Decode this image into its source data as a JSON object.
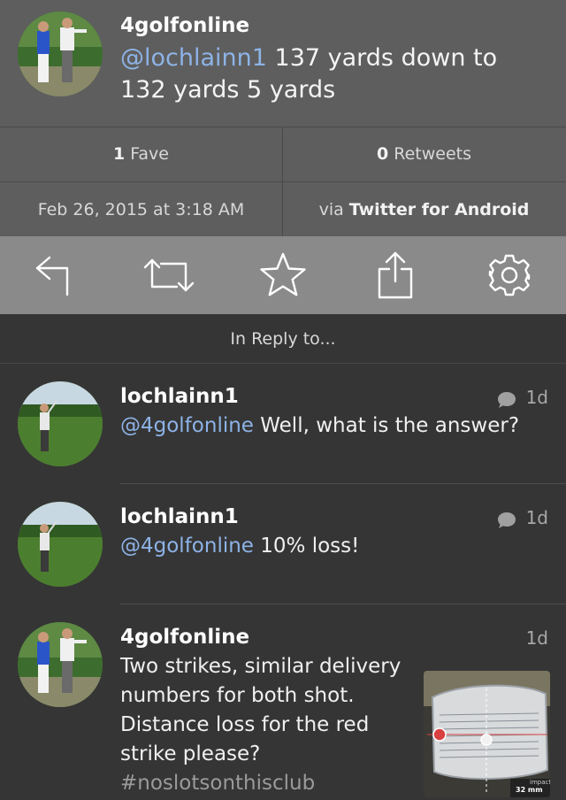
{
  "main_tweet": {
    "username": "4golfonline",
    "mention": "@lochlainn1",
    "text": " 137 yards down to 132 yards 5 yards"
  },
  "stats": {
    "faves_count": "1",
    "faves_label": "Fave",
    "retweets_count": "0",
    "retweets_label": "Retweets",
    "date": "Feb 26, 2015 at 3:18 AM",
    "via_prefix": "via",
    "via_app": "Twitter for Android"
  },
  "actions": [
    {
      "icon": "reply-icon"
    },
    {
      "icon": "retweet-icon"
    },
    {
      "icon": "star-icon"
    },
    {
      "icon": "share-icon"
    },
    {
      "icon": "gear-icon"
    }
  ],
  "in_reply_label": "In Reply to...",
  "replies": [
    {
      "username": "lochlainn1",
      "mention": "@4golfonline",
      "text": " Well, what is the answer?",
      "time": "1d",
      "has_bubble": true
    },
    {
      "username": "lochlainn1",
      "mention": "@4golfonline",
      "text": " 10% loss!",
      "time": "1d",
      "has_bubble": true
    },
    {
      "username": "4golfonline",
      "text": "Two strikes, similar delivery numbers for both shot. Distance loss for the red strike please?",
      "hashtag": "#noslotsonthisclub",
      "time": "1d",
      "has_bubble": false
    }
  ],
  "thumbnail": {
    "label": "impact",
    "value": "32 mm"
  },
  "colors": {
    "header_bg": "#5e5e5e",
    "action_bar_bg": "#8a8a8a",
    "body_bg": "#353535",
    "mention": "#8db3e6"
  }
}
